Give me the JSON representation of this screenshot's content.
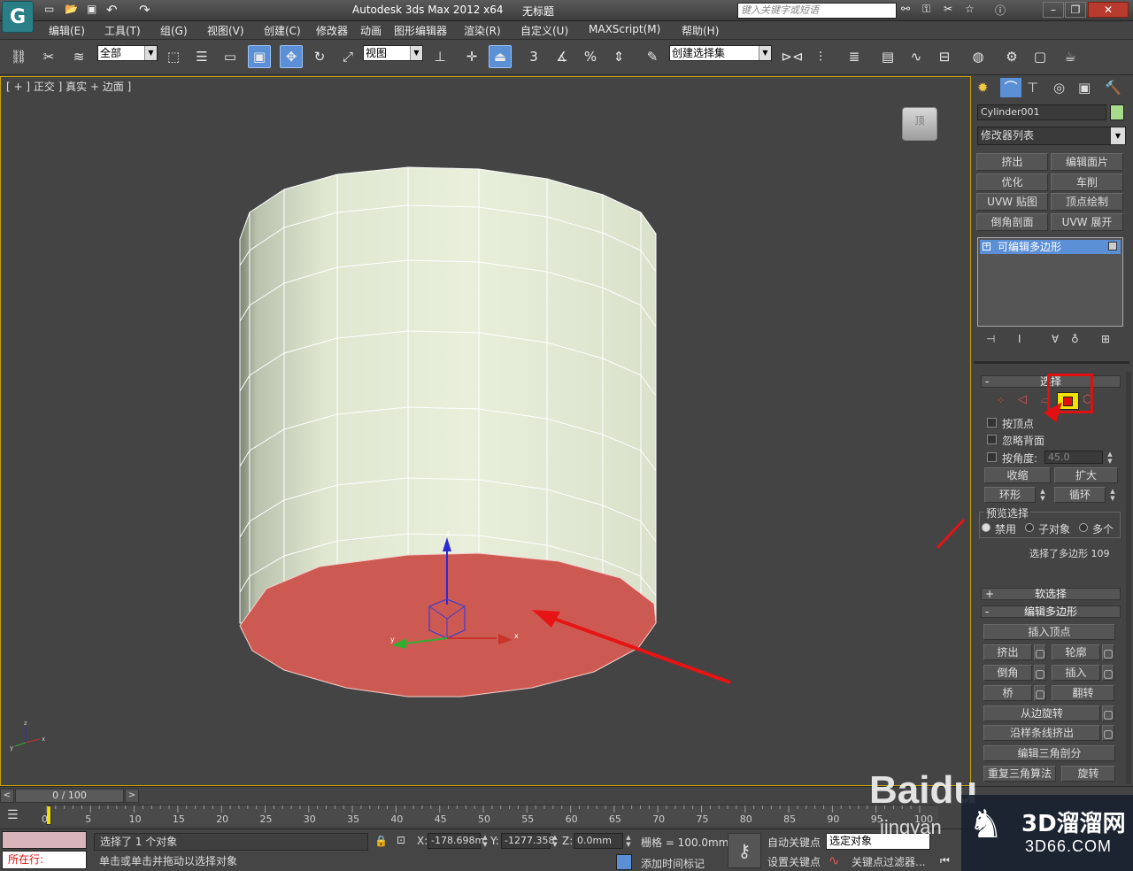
{
  "title": {
    "app": "Autodesk 3ds Max  2012 x64",
    "doc": "无标题",
    "search_placeholder": "键入关键字或短语"
  },
  "menu": [
    "编辑(E)",
    "工具(T)",
    "组(G)",
    "视图(V)",
    "创建(C)",
    "修改器",
    "动画",
    "图形编辑器",
    "渲染(R)",
    "自定义(U)",
    "MAXScript(M)",
    "帮助(H)"
  ],
  "toolbar": {
    "selection_filter": "全部",
    "ref_coord": "视图",
    "named_selection": "创建选择集",
    "snap_label": "3",
    "angle_label": "%"
  },
  "viewport": {
    "label": "[ + ] 正交 ] 真实 + 边面 ]",
    "viewcube": "顶"
  },
  "panel": {
    "object_name": "Cylinder001",
    "modifier_list": "修改器列表",
    "modifier_buttons": [
      "挤出",
      "编辑面片",
      "优化",
      "车削",
      "UVW 贴图",
      "顶点绘制",
      "倒角剖面",
      "UVW 展开"
    ],
    "stack_item": "可编辑多边形",
    "selection": {
      "header": "选择",
      "by_vertex": "按顶点",
      "ignore_backfacing": "忽略背面",
      "by_angle": "按角度:",
      "angle_value": "45.0",
      "shrink": "收缩",
      "grow": "扩大",
      "ring": "环形",
      "loop": "循环",
      "preview_label": "预览选择",
      "preview_disabled": "禁用",
      "preview_subobject": "子对象",
      "preview_multi": "多个",
      "status": "选择了多边形 109"
    },
    "soft_selection": "软选择",
    "edit_polygons": {
      "header": "编辑多边形",
      "insert_vertex": "插入顶点",
      "extrude": "挤出",
      "outline": "轮廓",
      "bevel": "倒角",
      "inset": "插入",
      "bridge": "桥",
      "flip": "翻转",
      "hinge_from_edge": "从边旋转",
      "extrude_along_spline": "沿样条线挤出",
      "edit_triangulation": "编辑三角剖分",
      "retriangulate": "重复三角算法",
      "turn": "旋转"
    }
  },
  "timeline": {
    "frame": "0 / 100",
    "ticks": [
      "0",
      "5",
      "10",
      "15",
      "20",
      "25",
      "30",
      "35",
      "40",
      "45",
      "50",
      "55",
      "60",
      "65",
      "70",
      "75",
      "80",
      "85",
      "90",
      "95",
      "100"
    ]
  },
  "status": {
    "selected": "选择了 1 个对象",
    "prompt": "单击或单击并拖动以选择对象",
    "maxscript": "所在行:",
    "x_label": "X:",
    "x": "-178.698m",
    "y_label": "Y:",
    "y": "-1277.358",
    "z_label": "Z:",
    "z": "0.0mm",
    "grid": "栅格 = 100.0mm",
    "auto_key": "自动关键点",
    "selected_obj": "选定对象",
    "set_key": "设置关键点",
    "key_filters": "关键点过滤器...",
    "add_time_tag": "添加时间标记"
  },
  "watermark": {
    "baidu": "Baidu",
    "jingyan": "jingyan",
    "site_cn": "3D溜溜网",
    "site_url": "3D66.COM"
  },
  "colors": {
    "cylinder": "#e4ecd6",
    "selected_face": "#cd5a52",
    "highlight_box": "#e01010",
    "arrow": "#e61414"
  }
}
